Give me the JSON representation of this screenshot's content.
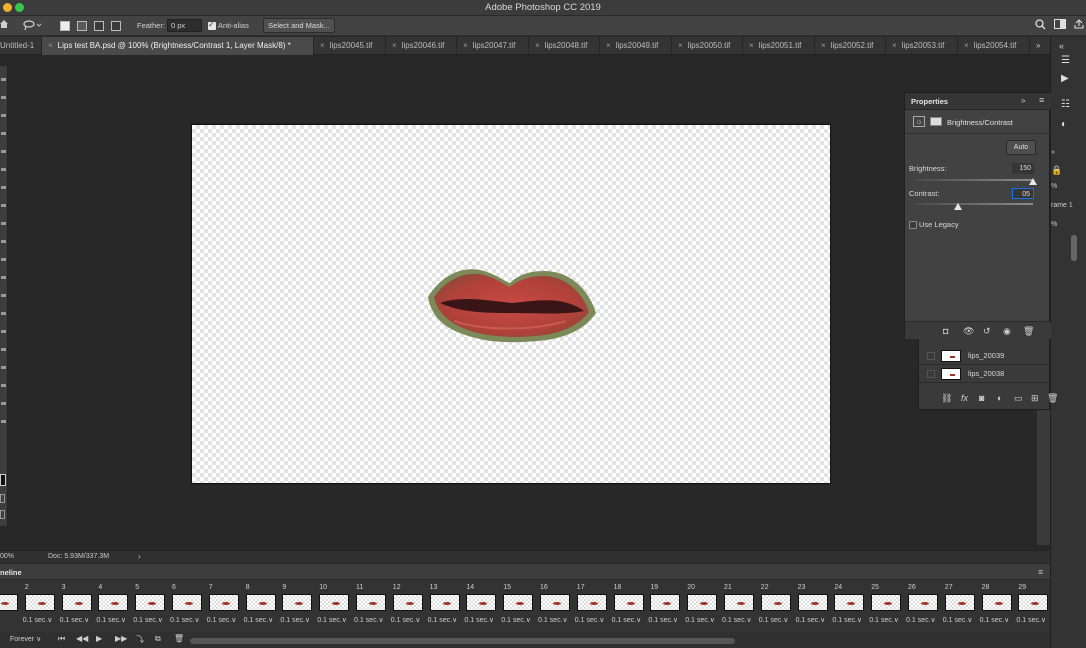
{
  "app": {
    "title": "Adobe Photoshop CC 2019"
  },
  "options_bar": {
    "feather_label": "Feather:",
    "feather_value": "0 px",
    "antialias_label": "Anti-alias",
    "select_mask_label": "Select and Mask..."
  },
  "tabs": [
    {
      "label": "Untitled-1",
      "active": false
    },
    {
      "label": "Lips test BA.psd @ 100% (Brightness/Contrast 1, Layer Mask/8) *",
      "active": true
    },
    {
      "label": "lips20045.tif",
      "active": false
    },
    {
      "label": "lips20046.tif",
      "active": false
    },
    {
      "label": "lips20047.tif",
      "active": false
    },
    {
      "label": "lips20048.tif",
      "active": false
    },
    {
      "label": "lips20049.tif",
      "active": false
    },
    {
      "label": "lips20050.tif",
      "active": false
    },
    {
      "label": "lips20051.tif",
      "active": false
    },
    {
      "label": "lips20052.tif",
      "active": false
    },
    {
      "label": "lips20053.tif",
      "active": false
    },
    {
      "label": "lips20054.tif",
      "active": false
    }
  ],
  "tabs_overflow": "»",
  "properties": {
    "title": "Properties",
    "adjustment": "Brightness/Contrast",
    "auto_label": "Auto",
    "brightness_label": "Brightness:",
    "brightness_value": "150",
    "brightness_level": 150,
    "contrast_label": "Contrast:",
    "contrast_value": "05",
    "contrast_level": 5,
    "legacy_label": "Use Legacy"
  },
  "layers": [
    {
      "name": "lips_20039"
    },
    {
      "name": "lips_20038"
    }
  ],
  "right_column": {
    "zoom_a": "%",
    "frame_label": "rame 1",
    "zoom_b": "%"
  },
  "status": {
    "zoom": "00%",
    "doc": "Doc: 5.93M/337.3M"
  },
  "timeline": {
    "title": "neline",
    "frames": [
      {
        "num": "",
        "delay": "sec."
      },
      {
        "num": "2",
        "delay": "0.1 sec.∨"
      },
      {
        "num": "3",
        "delay": "0.1 sec.∨"
      },
      {
        "num": "4",
        "delay": "0.1 sec.∨"
      },
      {
        "num": "5",
        "delay": "0.1 sec.∨"
      },
      {
        "num": "6",
        "delay": "0.1 sec.∨"
      },
      {
        "num": "7",
        "delay": "0.1 sec.∨"
      },
      {
        "num": "8",
        "delay": "0.1 sec.∨"
      },
      {
        "num": "9",
        "delay": "0.1 sec.∨"
      },
      {
        "num": "10",
        "delay": "0.1 sec.∨"
      },
      {
        "num": "11",
        "delay": "0.1 sec.∨"
      },
      {
        "num": "12",
        "delay": "0.1 sec.∨"
      },
      {
        "num": "13",
        "delay": "0.1 sec.∨"
      },
      {
        "num": "14",
        "delay": "0.1 sec.∨"
      },
      {
        "num": "15",
        "delay": "0.1 sec.∨"
      },
      {
        "num": "16",
        "delay": "0.1 sec.∨"
      },
      {
        "num": "17",
        "delay": "0.1 sec.∨"
      },
      {
        "num": "18",
        "delay": "0.1 sec.∨"
      },
      {
        "num": "19",
        "delay": "0.1 sec.∨"
      },
      {
        "num": "20",
        "delay": "0.1 sec.∨"
      },
      {
        "num": "21",
        "delay": "0.1 sec.∨"
      },
      {
        "num": "22",
        "delay": "0.1 sec.∨"
      },
      {
        "num": "23",
        "delay": "0.1 sec.∨"
      },
      {
        "num": "24",
        "delay": "0.1 sec.∨"
      },
      {
        "num": "25",
        "delay": "0.1 sec.∨"
      },
      {
        "num": "26",
        "delay": "0.1 sec.∨"
      },
      {
        "num": "27",
        "delay": "0.1 sec.∨"
      },
      {
        "num": "28",
        "delay": "0.1 sec.∨"
      },
      {
        "num": "29",
        "delay": "0.1 sec.∨"
      }
    ],
    "loop_label": "Forever"
  },
  "colors": {
    "accent_blue": "#1473e6",
    "lips_red": "#b0413a"
  }
}
